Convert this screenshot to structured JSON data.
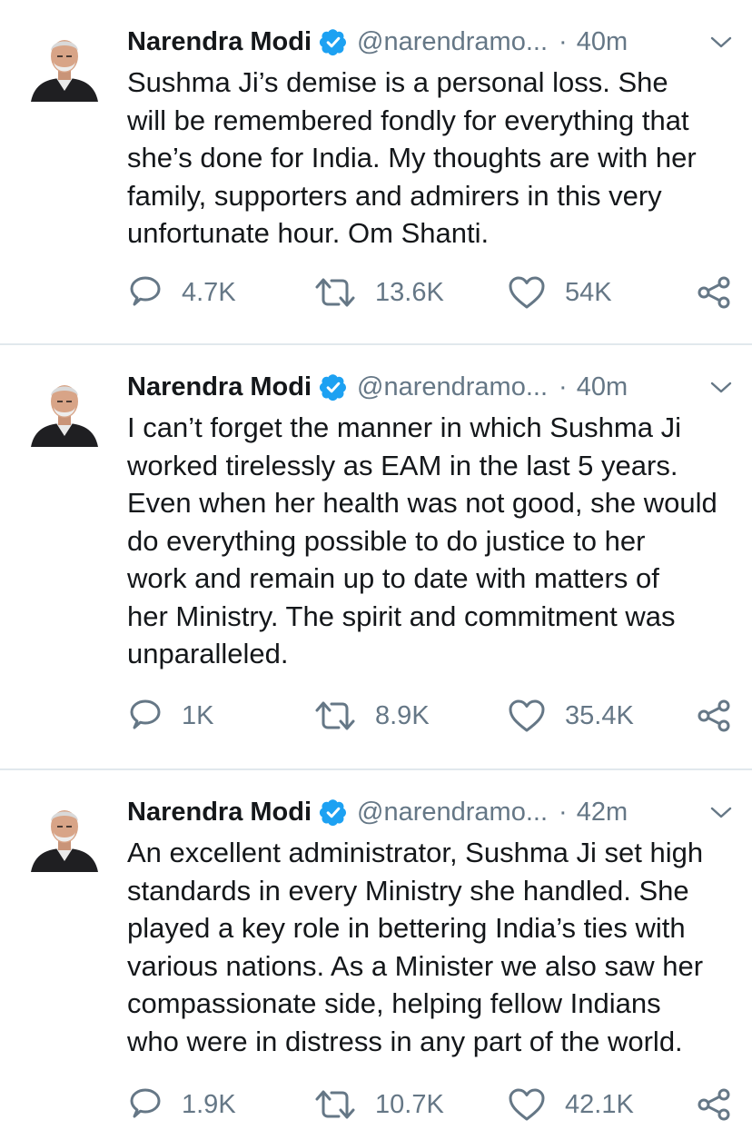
{
  "colors": {
    "verified_blue": "#1DA1F2",
    "secondary_text": "#657786",
    "primary_text": "#14171a",
    "divider": "#e1e8ed"
  },
  "tweets": [
    {
      "name": "Narendra Modi",
      "handle": "@narendramo...",
      "separator": "·",
      "time": "40m",
      "text": "Sushma Ji’s demise is a personal loss. She\nwill be remembered fondly for everything that\nshe’s done for India. My thoughts are with her\nfamily, supporters and admirers in this very\nunfortunate hour. Om Shanti.",
      "replies": "4.7K",
      "retweets": "13.6K",
      "likes": "54K"
    },
    {
      "name": "Narendra Modi",
      "handle": "@narendramo...",
      "separator": "·",
      "time": "40m",
      "text": "I can’t forget the manner in which Sushma Ji\nworked tirelessly as EAM in the last 5 years.\nEven when her health was not good, she would\ndo everything possible to do justice to her\nwork and remain up to date with matters of\nher Ministry. The spirit and commitment was\nunparalleled.",
      "replies": "1K",
      "retweets": "8.9K",
      "likes": "35.4K"
    },
    {
      "name": "Narendra Modi",
      "handle": "@narendramo...",
      "separator": "·",
      "time": "42m",
      "text": "An excellent administrator, Sushma Ji set high\nstandards in every Ministry she handled. She\nplayed a key role in bettering India’s ties with\nvarious nations. As a Minister we also saw her\ncompassionate side, helping fellow Indians\nwho were in distress in any part of the world.",
      "replies": "1.9K",
      "retweets": "10.7K",
      "likes": "42.1K"
    }
  ]
}
